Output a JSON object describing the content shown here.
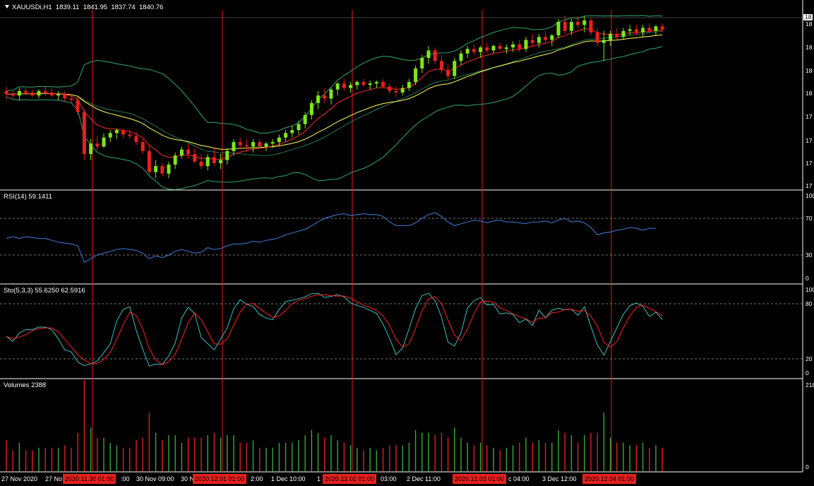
{
  "symbol_header": {
    "symbol": "XAUUSDi,H1",
    "open": "1839.11",
    "high": "1841.95",
    "low": "1837.74",
    "close": "1840.76"
  },
  "price_panel": {
    "last_price_label": "18",
    "y_tick_labels": [
      "18",
      "18",
      "18",
      "18",
      "17",
      "17",
      "17",
      "17"
    ]
  },
  "rsi_panel": {
    "title": "RSI(14) 59.1411",
    "levels": [
      "100",
      "70",
      "30",
      "0"
    ]
  },
  "stoch_panel": {
    "title": "Sto(5,3,3) 55.6250 62.5916",
    "levels": [
      "100",
      "80",
      "20",
      "0"
    ]
  },
  "volume_panel": {
    "title": "Volumes 2388",
    "levels": [
      "218",
      "0"
    ]
  },
  "time_axis": {
    "labels": [
      "27 Nov 2020",
      "27 No",
      ":00",
      "30 Nov 09:00",
      "30 N",
      "2:00",
      "1 Dec 10:00",
      "1",
      "03:00",
      "2 Dec 11:00",
      "c 04:00",
      "3 Dec 12:00"
    ],
    "vline_labels": [
      "2020.11.30 01:00",
      "2020.12.01 01:00",
      "2020.12.02 01:00",
      "2020.12.03 01:00",
      "2020.12.04 01:00"
    ]
  },
  "colors": {
    "background": "#000000",
    "grid_separator": "#ffffff",
    "bull_candle": "#7fe61a",
    "bear_candle": "#e8201e",
    "bollinger": "#2ea874",
    "ma_fast": "#ff2a2a",
    "ma_slow": "#ffff55",
    "rsi_line": "#3f7fe0",
    "stoch_main": "#3cc0c0",
    "stoch_signal": "#ff2020",
    "volume_up": "#3aa83a",
    "volume_down": "#e02020",
    "day_separator": "#e02020"
  },
  "chart_data": {
    "type": "candlestick",
    "timeframe": "H1",
    "x_unit": "hourly bars (index from 27 Nov 2020 ~08:00)",
    "panels": [
      "price",
      "RSI(14)",
      "Stochastic(5,3,3)",
      "Volumes"
    ],
    "candles": [
      [
        1818,
        1821,
        1812,
        1816
      ],
      [
        1816,
        1818,
        1813,
        1815
      ],
      [
        1815,
        1820,
        1812,
        1818
      ],
      [
        1818,
        1820,
        1815,
        1817
      ],
      [
        1817,
        1819,
        1814,
        1815
      ],
      [
        1815,
        1819,
        1813,
        1818
      ],
      [
        1818,
        1821,
        1815,
        1817
      ],
      [
        1817,
        1820,
        1814,
        1815
      ],
      [
        1815,
        1818,
        1812,
        1816
      ],
      [
        1816,
        1818,
        1811,
        1813
      ],
      [
        1813,
        1816,
        1810,
        1812
      ],
      [
        1812,
        1814,
        1802,
        1804
      ],
      [
        1804,
        1806,
        1772,
        1776
      ],
      [
        1776,
        1786,
        1772,
        1783
      ],
      [
        1783,
        1788,
        1778,
        1781
      ],
      [
        1781,
        1790,
        1780,
        1787
      ],
      [
        1787,
        1792,
        1784,
        1790
      ],
      [
        1790,
        1793,
        1786,
        1792
      ],
      [
        1792,
        1793,
        1787,
        1789
      ],
      [
        1789,
        1792,
        1786,
        1788
      ],
      [
        1788,
        1791,
        1782,
        1784
      ],
      [
        1784,
        1786,
        1776,
        1778
      ],
      [
        1778,
        1782,
        1762,
        1764
      ],
      [
        1764,
        1772,
        1760,
        1768
      ],
      [
        1768,
        1770,
        1761,
        1763
      ],
      [
        1763,
        1771,
        1760,
        1769
      ],
      [
        1769,
        1777,
        1766,
        1775
      ],
      [
        1775,
        1781,
        1773,
        1779
      ],
      [
        1779,
        1783,
        1773,
        1776
      ],
      [
        1776,
        1780,
        1770,
        1771
      ],
      [
        1771,
        1776,
        1766,
        1768
      ],
      [
        1768,
        1776,
        1765,
        1774
      ],
      [
        1774,
        1780,
        1768,
        1770
      ],
      [
        1770,
        1776,
        1766,
        1772
      ],
      [
        1772,
        1780,
        1769,
        1778
      ],
      [
        1778,
        1786,
        1775,
        1784
      ],
      [
        1784,
        1787,
        1779,
        1782
      ],
      [
        1782,
        1786,
        1778,
        1781
      ],
      [
        1781,
        1786,
        1777,
        1784
      ],
      [
        1784,
        1786,
        1780,
        1781
      ],
      [
        1781,
        1784,
        1778,
        1783
      ],
      [
        1783,
        1786,
        1780,
        1784
      ],
      [
        1784,
        1789,
        1781,
        1787
      ],
      [
        1787,
        1792,
        1784,
        1790
      ],
      [
        1790,
        1795,
        1787,
        1792
      ],
      [
        1792,
        1798,
        1789,
        1796
      ],
      [
        1796,
        1804,
        1793,
        1802
      ],
      [
        1802,
        1812,
        1799,
        1810
      ],
      [
        1810,
        1818,
        1806,
        1815
      ],
      [
        1815,
        1820,
        1810,
        1813
      ],
      [
        1813,
        1820,
        1809,
        1819
      ],
      [
        1819,
        1824,
        1815,
        1823
      ],
      [
        1823,
        1826,
        1818,
        1820
      ],
      [
        1820,
        1824,
        1817,
        1822
      ],
      [
        1822,
        1825,
        1819,
        1824
      ],
      [
        1824,
        1826,
        1821,
        1822
      ],
      [
        1822,
        1825,
        1819,
        1823
      ],
      [
        1823,
        1825,
        1820,
        1824
      ],
      [
        1824,
        1826,
        1820,
        1821
      ],
      [
        1821,
        1823,
        1816,
        1818
      ],
      [
        1818,
        1821,
        1814,
        1817
      ],
      [
        1817,
        1822,
        1815,
        1820
      ],
      [
        1820,
        1826,
        1818,
        1824
      ],
      [
        1824,
        1835,
        1822,
        1833
      ],
      [
        1833,
        1842,
        1830,
        1840
      ],
      [
        1840,
        1848,
        1836,
        1845
      ],
      [
        1845,
        1847,
        1836,
        1838
      ],
      [
        1838,
        1842,
        1830,
        1832
      ],
      [
        1832,
        1836,
        1826,
        1828
      ],
      [
        1828,
        1840,
        1826,
        1838
      ],
      [
        1838,
        1845,
        1835,
        1843
      ],
      [
        1843,
        1848,
        1840,
        1846
      ],
      [
        1846,
        1849,
        1842,
        1844
      ],
      [
        1844,
        1848,
        1840,
        1847
      ],
      [
        1847,
        1850,
        1843,
        1845
      ],
      [
        1845,
        1849,
        1843,
        1848
      ],
      [
        1848,
        1850,
        1845,
        1846
      ],
      [
        1846,
        1849,
        1843,
        1847
      ],
      [
        1847,
        1851,
        1844,
        1849
      ],
      [
        1849,
        1852,
        1844,
        1846
      ],
      [
        1846,
        1854,
        1844,
        1852
      ],
      [
        1852,
        1856,
        1848,
        1850
      ],
      [
        1850,
        1856,
        1847,
        1854
      ],
      [
        1854,
        1858,
        1850,
        1852
      ],
      [
        1852,
        1856,
        1848,
        1855
      ],
      [
        1855,
        1866,
        1853,
        1864
      ],
      [
        1864,
        1868,
        1856,
        1858
      ],
      [
        1858,
        1866,
        1855,
        1864
      ],
      [
        1864,
        1868,
        1860,
        1862
      ],
      [
        1862,
        1868,
        1857,
        1865
      ],
      [
        1865,
        1867,
        1855,
        1857
      ],
      [
        1857,
        1860,
        1848,
        1850
      ],
      [
        1850,
        1858,
        1838,
        1852
      ],
      [
        1852,
        1858,
        1848,
        1856
      ],
      [
        1856,
        1860,
        1852,
        1854
      ],
      [
        1854,
        1860,
        1852,
        1858
      ],
      [
        1858,
        1862,
        1855,
        1859
      ],
      [
        1859,
        1862,
        1855,
        1857
      ],
      [
        1857,
        1862,
        1854,
        1860
      ],
      [
        1860,
        1863,
        1857,
        1858
      ],
      [
        1858,
        1862,
        1855,
        1861
      ],
      [
        1861,
        1863,
        1857,
        1859
      ]
    ],
    "rsi": [
      48,
      50,
      48,
      50,
      49,
      48,
      48,
      46,
      44,
      43,
      42,
      40,
      22,
      26,
      30,
      32,
      34,
      36,
      37,
      36,
      35,
      32,
      26,
      29,
      27,
      30,
      34,
      36,
      34,
      32,
      33,
      38,
      36,
      37,
      40,
      42,
      42,
      43,
      45,
      44,
      46,
      47,
      49,
      52,
      54,
      56,
      58,
      62,
      66,
      70,
      72,
      74,
      75,
      73,
      74,
      75,
      74,
      74,
      72,
      66,
      62,
      62,
      62,
      65,
      70,
      74,
      76,
      72,
      66,
      62,
      64,
      66,
      68,
      67,
      65,
      67,
      68,
      66,
      66,
      65,
      64,
      66,
      66,
      67,
      65,
      68,
      70,
      66,
      67,
      65,
      60,
      52,
      54,
      55,
      57,
      58,
      60,
      59,
      57,
      59,
      59
    ]
  }
}
